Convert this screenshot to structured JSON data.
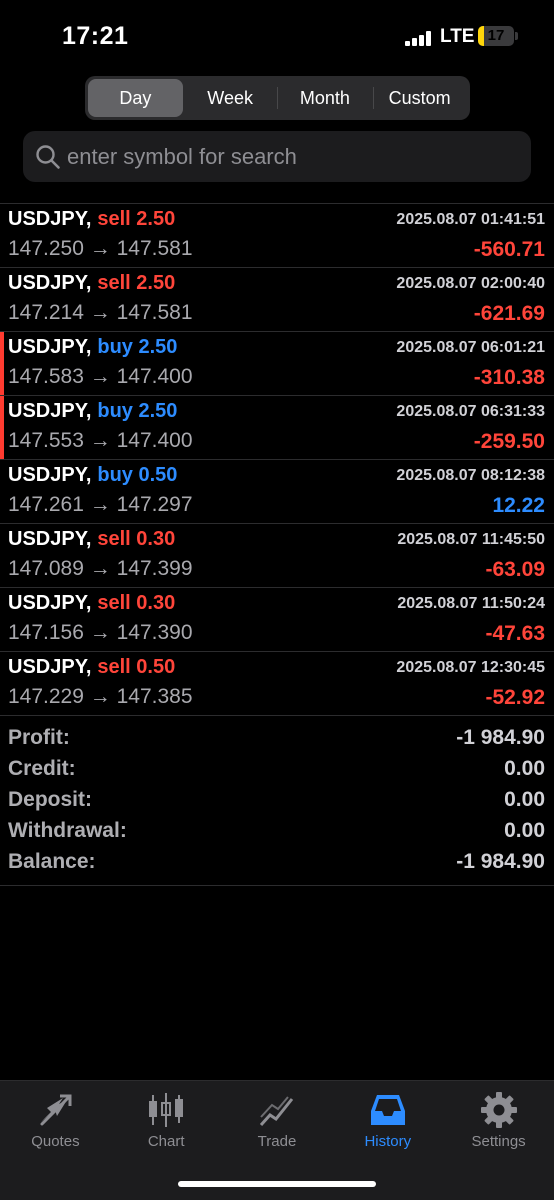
{
  "status": {
    "time": "17:21",
    "network": "LTE",
    "battery": "17",
    "battery_level_percent": 17,
    "battery_color": "#ffd60a"
  },
  "periods": [
    "Day",
    "Week",
    "Month",
    "Custom"
  ],
  "active_period": "Day",
  "search": {
    "placeholder": "enter symbol for search",
    "value": ""
  },
  "colors": {
    "sell": "#ff453a",
    "buy": "#2d8cff",
    "loss": "#ff453a",
    "gain": "#2d8cff",
    "active_tab": "#2d8cff"
  },
  "deals": [
    {
      "symbol": "USDJPY,",
      "side": "sell 2.50",
      "type": "sell",
      "open": "147.250",
      "arrow": "→",
      "close": "147.581",
      "datetime": "2025.08.07 01:41:51",
      "profit": "-560.71",
      "marked": false
    },
    {
      "symbol": "USDJPY,",
      "side": "sell 2.50",
      "type": "sell",
      "open": "147.214",
      "arrow": "→",
      "close": "147.581",
      "datetime": "2025.08.07 02:00:40",
      "profit": "-621.69",
      "marked": false
    },
    {
      "symbol": "USDJPY,",
      "side": "buy 2.50",
      "type": "buy",
      "open": "147.583",
      "arrow": "→",
      "close": "147.400",
      "datetime": "2025.08.07 06:01:21",
      "profit": "-310.38",
      "marked": true
    },
    {
      "symbol": "USDJPY,",
      "side": "buy 2.50",
      "type": "buy",
      "open": "147.553",
      "arrow": "→",
      "close": "147.400",
      "datetime": "2025.08.07 06:31:33",
      "profit": "-259.50",
      "marked": true
    },
    {
      "symbol": "USDJPY,",
      "side": "buy 0.50",
      "type": "buy",
      "open": "147.261",
      "arrow": "→",
      "close": "147.297",
      "datetime": "2025.08.07 08:12:38",
      "profit": "12.22",
      "marked": false
    },
    {
      "symbol": "USDJPY,",
      "side": "sell 0.30",
      "type": "sell",
      "open": "147.089",
      "arrow": "→",
      "close": "147.399",
      "datetime": "2025.08.07 11:45:50",
      "profit": "-63.09",
      "marked": false
    },
    {
      "symbol": "USDJPY,",
      "side": "sell 0.30",
      "type": "sell",
      "open": "147.156",
      "arrow": "→",
      "close": "147.390",
      "datetime": "2025.08.07 11:50:24",
      "profit": "-47.63",
      "marked": false
    },
    {
      "symbol": "USDJPY,",
      "side": "sell 0.50",
      "type": "sell",
      "open": "147.229",
      "arrow": "→",
      "close": "147.385",
      "datetime": "2025.08.07 12:30:45",
      "profit": "-52.92",
      "marked": false
    }
  ],
  "summary": [
    {
      "label": "Profit:",
      "value": "-1 984.90"
    },
    {
      "label": "Credit:",
      "value": "0.00"
    },
    {
      "label": "Deposit:",
      "value": "0.00"
    },
    {
      "label": "Withdrawal:",
      "value": "0.00"
    },
    {
      "label": "Balance:",
      "value": "-1 984.90"
    }
  ],
  "tabs": [
    {
      "label": "Quotes",
      "icon": "quotes-icon",
      "active": false
    },
    {
      "label": "Chart",
      "icon": "candlestick-chart-icon",
      "active": false
    },
    {
      "label": "Trade",
      "icon": "trade-line-icon",
      "active": false
    },
    {
      "label": "History",
      "icon": "history-inbox-icon",
      "active": true
    },
    {
      "label": "Settings",
      "icon": "gear-icon",
      "active": false
    }
  ]
}
